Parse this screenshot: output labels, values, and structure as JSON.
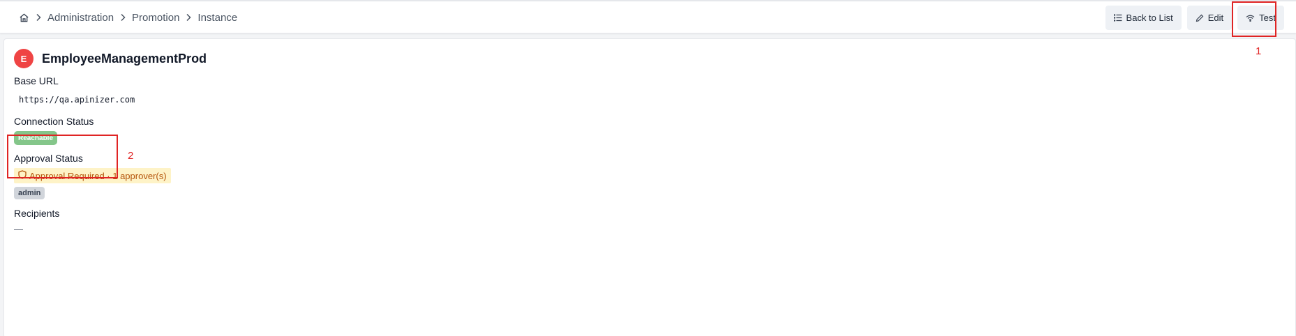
{
  "breadcrumb": {
    "home_icon": "home-icon",
    "items": [
      "Administration",
      "Promotion",
      "Instance"
    ]
  },
  "toolbar": {
    "back_label": "Back to List",
    "edit_label": "Edit",
    "test_label": "Test"
  },
  "instance": {
    "avatar_letter": "E",
    "name": "EmployeeManagementProd",
    "base_url_label": "Base URL",
    "base_url": "https://qa.apinizer.com",
    "connection_label": "Connection Status",
    "connection_status": "Reachable",
    "approval_label": "Approval Status",
    "approval_status": "Approval Required · 1 approver(s)",
    "approver": "admin",
    "recipients_label": "Recipients",
    "recipients_value": "—"
  },
  "annotations": {
    "first": "1",
    "second": "2"
  },
  "colors": {
    "accent_red": "#ef4444",
    "reachable": "#84c68a",
    "approval_bg": "#fef3c7",
    "approval_text": "#b45309",
    "annotation": "#e02424"
  }
}
